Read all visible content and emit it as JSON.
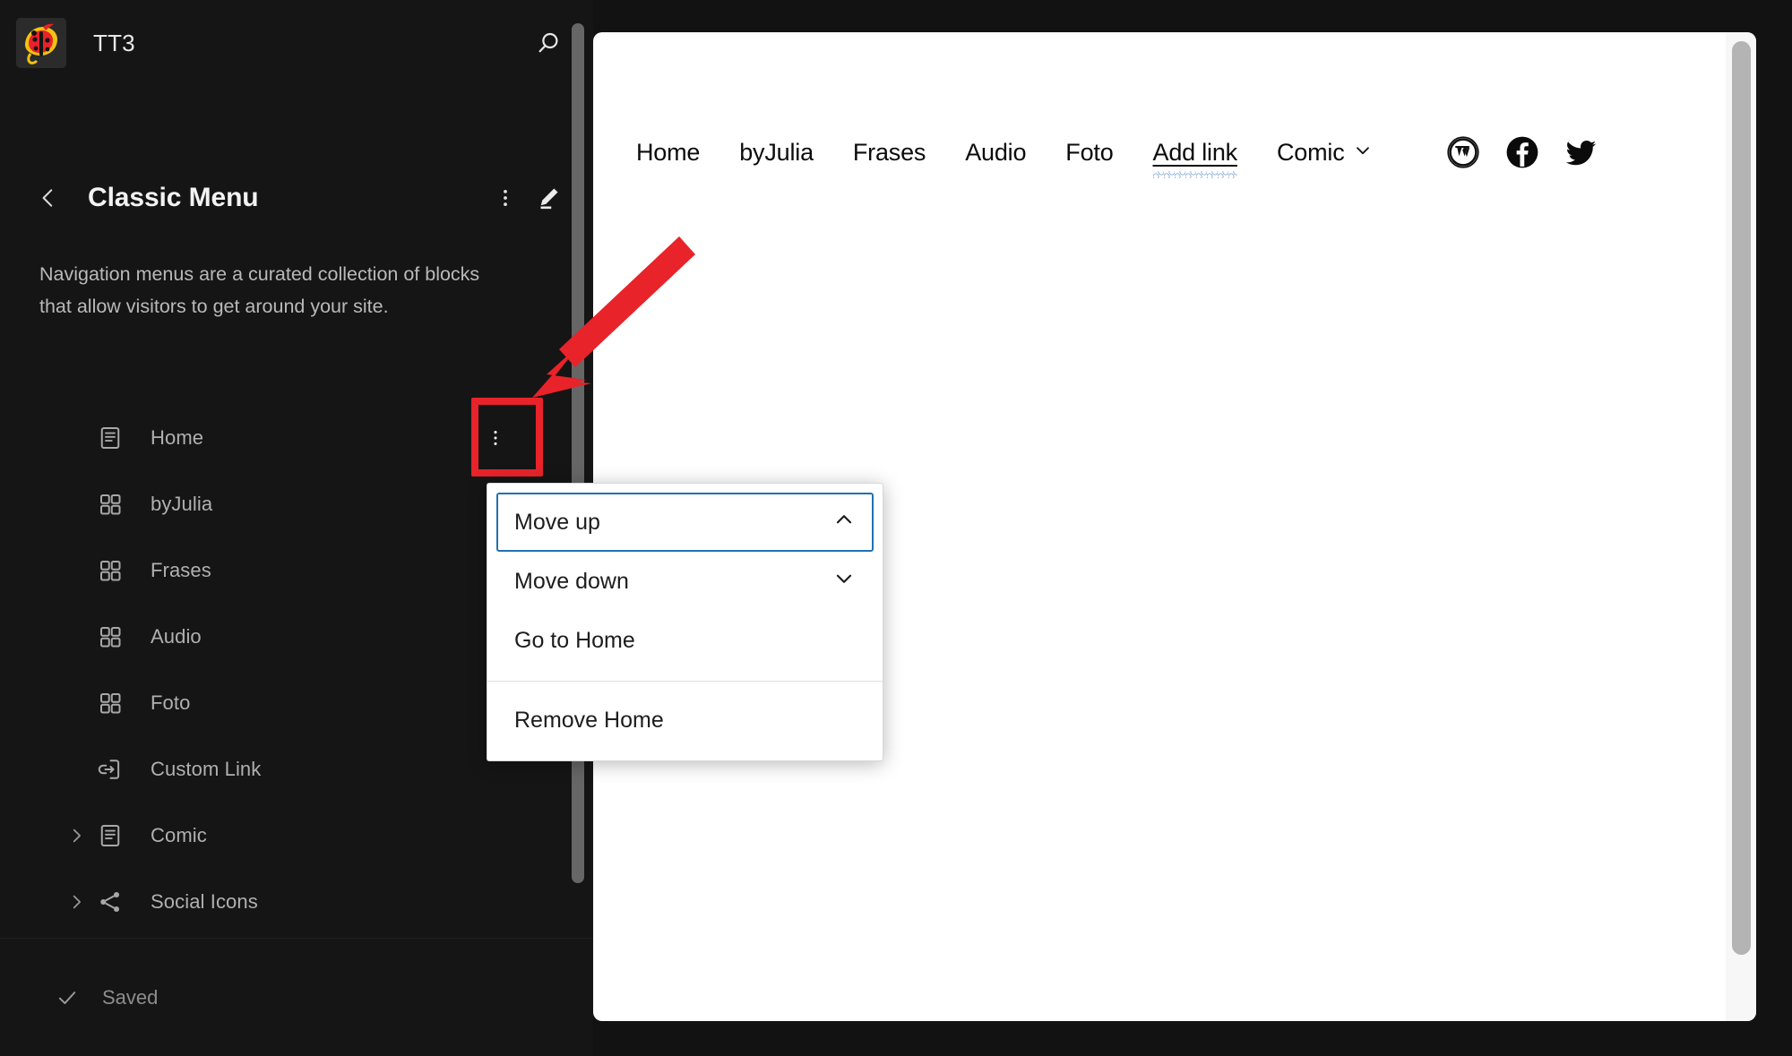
{
  "app": {
    "background_color": "#121212",
    "accent_color": "#2271b1",
    "annotation_color": "#e8232a"
  },
  "sidebar": {
    "site": {
      "title": "TT3",
      "icon_name": "site-logo-ladybug",
      "search_icon": "search-icon"
    },
    "panel": {
      "back_icon": "chevron-left-icon",
      "title": "Classic Menu",
      "options_icon": "ellipsis-vertical-icon",
      "edit_icon": "pencil-icon",
      "description": "Navigation menus are a curated collection of blocks that allow visitors to get around your site."
    },
    "blocks": [
      {
        "label": "Home",
        "icon": "page-icon",
        "expandable": false,
        "has_options": true
      },
      {
        "label": "byJulia",
        "icon": "page-list-icon",
        "expandable": false,
        "has_options": false
      },
      {
        "label": "Frases",
        "icon": "page-list-icon",
        "expandable": false,
        "has_options": false
      },
      {
        "label": "Audio",
        "icon": "page-list-icon",
        "expandable": false,
        "has_options": false
      },
      {
        "label": "Foto",
        "icon": "page-list-icon",
        "expandable": false,
        "has_options": false
      },
      {
        "label": "Custom Link",
        "icon": "custom-link-icon",
        "expandable": false,
        "has_options": false
      },
      {
        "label": "Comic",
        "icon": "page-icon",
        "expandable": true,
        "has_options": false
      },
      {
        "label": "Social Icons",
        "icon": "share-icon",
        "expandable": true,
        "has_options": false
      }
    ],
    "footer": {
      "check_icon": "checkmark-icon",
      "status": "Saved"
    }
  },
  "popover": {
    "items": [
      {
        "label": "Move up",
        "icon": "chevron-up-icon",
        "focused": true,
        "separator_after": false
      },
      {
        "label": "Move down",
        "icon": "chevron-down-icon",
        "focused": false,
        "separator_after": false
      },
      {
        "label": "Go to Home",
        "icon": "",
        "focused": false,
        "separator_after": true
      },
      {
        "label": "Remove Home",
        "icon": "",
        "focused": false,
        "separator_after": false
      }
    ]
  },
  "canvas": {
    "nav_items": [
      {
        "label": "Home",
        "style": "plain",
        "chevron": false
      },
      {
        "label": "byJulia",
        "style": "plain",
        "chevron": false
      },
      {
        "label": "Frases",
        "style": "plain",
        "chevron": false
      },
      {
        "label": "Audio",
        "style": "plain",
        "chevron": false
      },
      {
        "label": "Foto",
        "style": "plain",
        "chevron": false
      },
      {
        "label": "Add link",
        "style": "underlined",
        "chevron": false
      },
      {
        "label": "Comic",
        "style": "plain",
        "chevron": true
      }
    ],
    "social_icons": [
      {
        "name": "wordpress-icon"
      },
      {
        "name": "facebook-icon"
      },
      {
        "name": "twitter-icon"
      }
    ]
  },
  "annotations": {
    "highlight_target": "Home row options button",
    "arrow": "points to Home row options button"
  }
}
